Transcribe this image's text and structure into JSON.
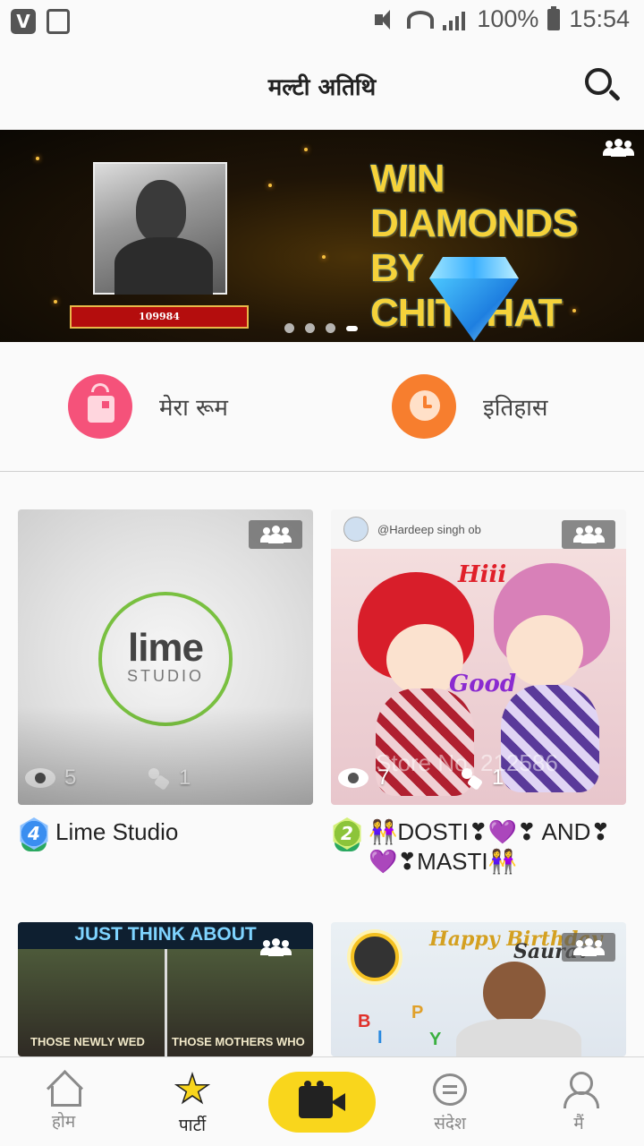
{
  "status_bar": {
    "battery": "100%",
    "time": "15:54",
    "left_icons": [
      "v-app-icon",
      "message-sync-icon"
    ],
    "right_icons": [
      "mute-icon",
      "wifi-icon",
      "signal-icon",
      "battery-icon"
    ]
  },
  "header": {
    "title": "मल्टी अतिथि",
    "search_icon": "search-icon"
  },
  "banner": {
    "headline_line1": "WIN DIAMONDS",
    "headline_line2": "BY CHITCHAT",
    "ribbon_id": "109984",
    "carousel_count": 4,
    "active_index": 3,
    "colors": {
      "headline": "#f5d23a",
      "ribbon": "#b40d0d"
    }
  },
  "quick_actions": [
    {
      "label": "मेरा रूम",
      "icon": "room-icon",
      "color": "#f5527a"
    },
    {
      "label": "इतिहास",
      "icon": "history-clock-icon",
      "color": "#f77e2e"
    }
  ],
  "rooms": [
    {
      "title": "Lime Studio",
      "level": "4",
      "viewers": "5",
      "speakers": "1",
      "art": {
        "word": "lime",
        "sub": "STUDIO"
      }
    },
    {
      "title": "👭DOSTI❣💜❣ AND❣💜❣MASTI👭",
      "level": "2",
      "viewers": "7",
      "speakers": "1",
      "art": {
        "handle": "@Hardeep singh ob",
        "hiii": "Hiii",
        "good": "Good",
        "watermark": "Store No. 212586"
      }
    },
    {
      "art": {
        "headline": "JUST THINK ABOUT",
        "cap_left": "THOSE NEWLY WED",
        "cap_right": "THOSE MOTHERS WHO"
      }
    },
    {
      "art": {
        "happy": "Happy Birthday",
        "name": "Saurav"
      }
    }
  ],
  "bottom_nav": {
    "items": [
      {
        "label": "होम",
        "icon": "home-icon"
      },
      {
        "label": "पार्टी",
        "icon": "star-icon",
        "active": true
      },
      {
        "label": "",
        "icon": "video-camera-icon"
      },
      {
        "label": "संदेश",
        "icon": "chat-bubble-icon"
      },
      {
        "label": "मैं",
        "icon": "user-icon"
      }
    ],
    "colors": {
      "accent": "#f9d61c"
    }
  }
}
